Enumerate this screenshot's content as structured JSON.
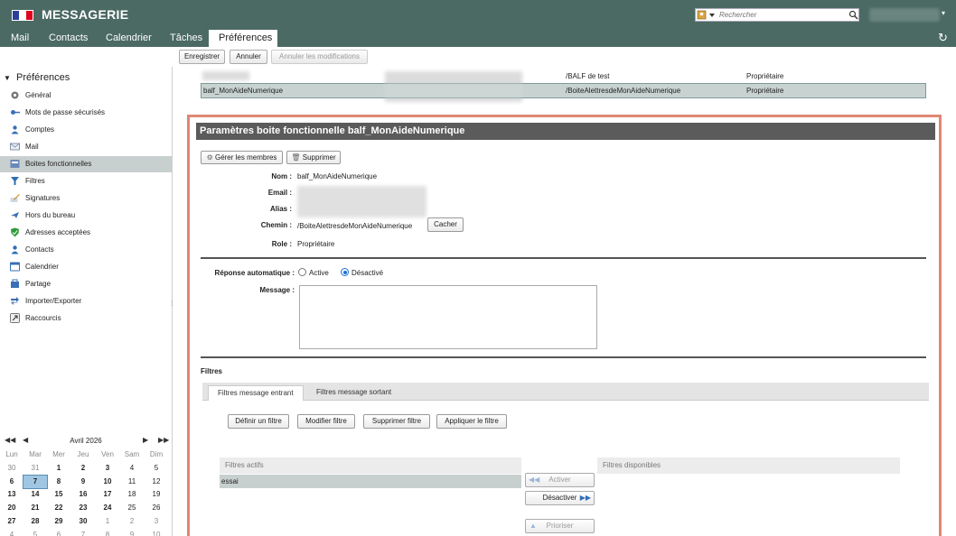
{
  "header": {
    "app_title": "MESSAGERIE",
    "search": {
      "placeholder": "Rechercher"
    },
    "tabs": [
      {
        "label": "Mail"
      },
      {
        "label": "Contacts"
      },
      {
        "label": "Calendrier"
      },
      {
        "label": "Tâches"
      },
      {
        "label": "Préférences",
        "active": true
      }
    ]
  },
  "toolbar": {
    "save": "Enregistrer",
    "cancel": "Annuler",
    "undo": "Annuler les modifications"
  },
  "sidebar": {
    "title": "Préférences",
    "items": [
      {
        "label": "Général",
        "icon": "gear-icon"
      },
      {
        "label": "Mots de passe sécurisés",
        "icon": "key-icon"
      },
      {
        "label": "Comptes",
        "icon": "user-icon"
      },
      {
        "label": "Mail",
        "icon": "mail-icon"
      },
      {
        "label": "Boites fonctionnelles",
        "icon": "mailbox-icon",
        "selected": true
      },
      {
        "label": "Filtres",
        "icon": "filter-icon"
      },
      {
        "label": "Signatures",
        "icon": "pen-icon"
      },
      {
        "label": "Hors du bureau",
        "icon": "plane-icon"
      },
      {
        "label": "Adresses acceptées",
        "icon": "shield-icon"
      },
      {
        "label": "Contacts",
        "icon": "contacts-icon"
      },
      {
        "label": "Calendrier",
        "icon": "calendar-icon"
      },
      {
        "label": "Partage",
        "icon": "share-icon"
      },
      {
        "label": "Importer/Exporter",
        "icon": "import-export-icon"
      },
      {
        "label": "Raccourcis",
        "icon": "shortcut-icon"
      }
    ]
  },
  "calendar": {
    "month": "Avril 2026",
    "weekdays": [
      "Lun",
      "Mar",
      "Mer",
      "Jeu",
      "Ven",
      "Sam",
      "Dim"
    ],
    "weeks": [
      [
        "30",
        "31",
        "1",
        "2",
        "3",
        "4",
        "5"
      ],
      [
        "6",
        "7",
        "8",
        "9",
        "10",
        "11",
        "12"
      ],
      [
        "13",
        "14",
        "15",
        "16",
        "17",
        "18",
        "19"
      ],
      [
        "20",
        "21",
        "22",
        "23",
        "24",
        "25",
        "26"
      ],
      [
        "27",
        "28",
        "29",
        "30",
        "1",
        "2",
        "3"
      ],
      [
        "4",
        "5",
        "6",
        "7",
        "8",
        "9",
        "10"
      ]
    ],
    "today": "7"
  },
  "list": {
    "rows": [
      {
        "name": "",
        "path": "/BALF de test",
        "role": "Propriétaire"
      },
      {
        "name": "balf_MonAideNumerique",
        "path": "/BoiteAlettresdeMonAideNumerique",
        "role": "Propriétaire",
        "selected": true
      }
    ]
  },
  "panel": {
    "title": "Paramètres boite fonctionnelle balf_MonAideNumerique",
    "manage_members": "Gérer les membres",
    "delete": "Supprimer",
    "fields": {
      "nom_label": "Nom :",
      "nom": "balf_MonAideNumerique",
      "email_label": "Email :",
      "alias_label": "Alias :",
      "chemin_label": "Chemin :",
      "chemin": "/BoiteAlettresdeMonAideNumerique",
      "hide": "Cacher",
      "role_label": "Role :",
      "role": "Propriétaire"
    },
    "auto_reply": {
      "label": "Réponse automatique :",
      "active": "Active",
      "inactive": "Désactivé",
      "selected": "Désactivé",
      "message_label": "Message :"
    },
    "filters": {
      "title": "Filtres",
      "tabs": [
        "Filtres message entrant",
        "Filtres message sortant"
      ],
      "buttons": [
        "Définir un filtre",
        "Modifier filtre",
        "Supprimer filtre",
        "Appliquer le filtre"
      ],
      "active_header": "Filtres actifs",
      "available_header": "Filtres disponibles",
      "active_items": [
        "essai"
      ],
      "activate": "Activer",
      "deactivate": "Désactiver",
      "prioritize": "Prioriser"
    }
  }
}
